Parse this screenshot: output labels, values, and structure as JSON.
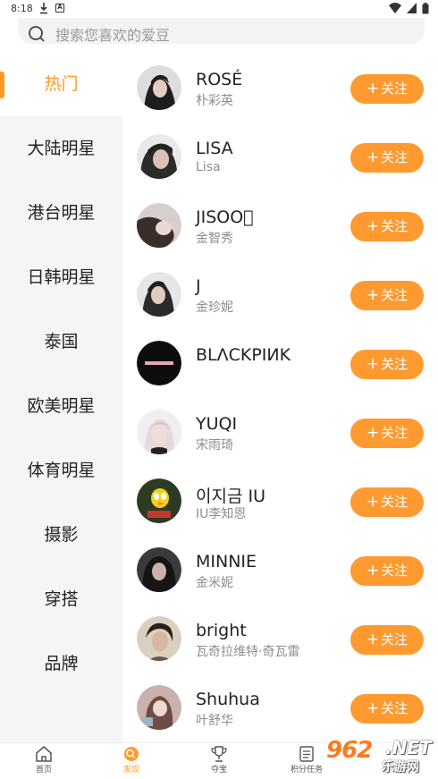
{
  "status_bar": {
    "time": "8:18"
  },
  "search": {
    "placeholder": "搜索您喜欢的爱豆"
  },
  "sidebar": {
    "items": [
      {
        "label": "热门",
        "active": true
      },
      {
        "label": "大陆明星"
      },
      {
        "label": "港台明星"
      },
      {
        "label": "日韩明星"
      },
      {
        "label": "泰国"
      },
      {
        "label": "欧美明星"
      },
      {
        "label": "体育明星"
      },
      {
        "label": "摄影"
      },
      {
        "label": "穿搭"
      },
      {
        "label": "品牌"
      }
    ]
  },
  "follow_label": "关注",
  "follow_plus": "+",
  "stars": [
    {
      "name": "ROSÉ",
      "sub": "朴彩英",
      "avatar_color": "#2a2a2a"
    },
    {
      "name": "LISA",
      "sub": "Lisa",
      "avatar_color": "#3b3b3b"
    },
    {
      "name": "JISOO\u0000",
      "sub": "金智秀",
      "avatar_color": "#c9bfbd"
    },
    {
      "name": "J",
      "sub": "金珍妮",
      "avatar_color": "#5a5a5a"
    },
    {
      "name": "BLΛCKPIИK",
      "sub": "",
      "avatar_color": "#0d0d0d"
    },
    {
      "name": "YUQI",
      "sub": "宋雨琦",
      "avatar_color": "#e8e0e6"
    },
    {
      "name": "이지금 IU",
      "sub": "IU李知恩",
      "avatar_color": "#2c3b22"
    },
    {
      "name": "MINNIE",
      "sub": "金米妮",
      "avatar_color": "#262626"
    },
    {
      "name": "bright",
      "sub": "瓦奇拉维特·奇瓦雷",
      "avatar_color": "#c4b8a4"
    },
    {
      "name": "Shuhua",
      "sub": "叶舒华",
      "avatar_color": "#b49a92"
    }
  ],
  "tabbar": {
    "items": [
      {
        "label": "首页",
        "icon": "home-icon"
      },
      {
        "label": "发现",
        "icon": "discover-icon",
        "active": true
      },
      {
        "label": "夺宝",
        "icon": "trophy-icon"
      },
      {
        "label": "积分任务",
        "icon": "task-list-icon"
      }
    ]
  },
  "watermark": {
    "number": "962",
    "suffix": ".NET",
    "site": "乐游网"
  },
  "colors": {
    "accent": "#ff9a26",
    "sidebar_bg": "#f5f5f7",
    "follow_button": "#ff9a30"
  }
}
